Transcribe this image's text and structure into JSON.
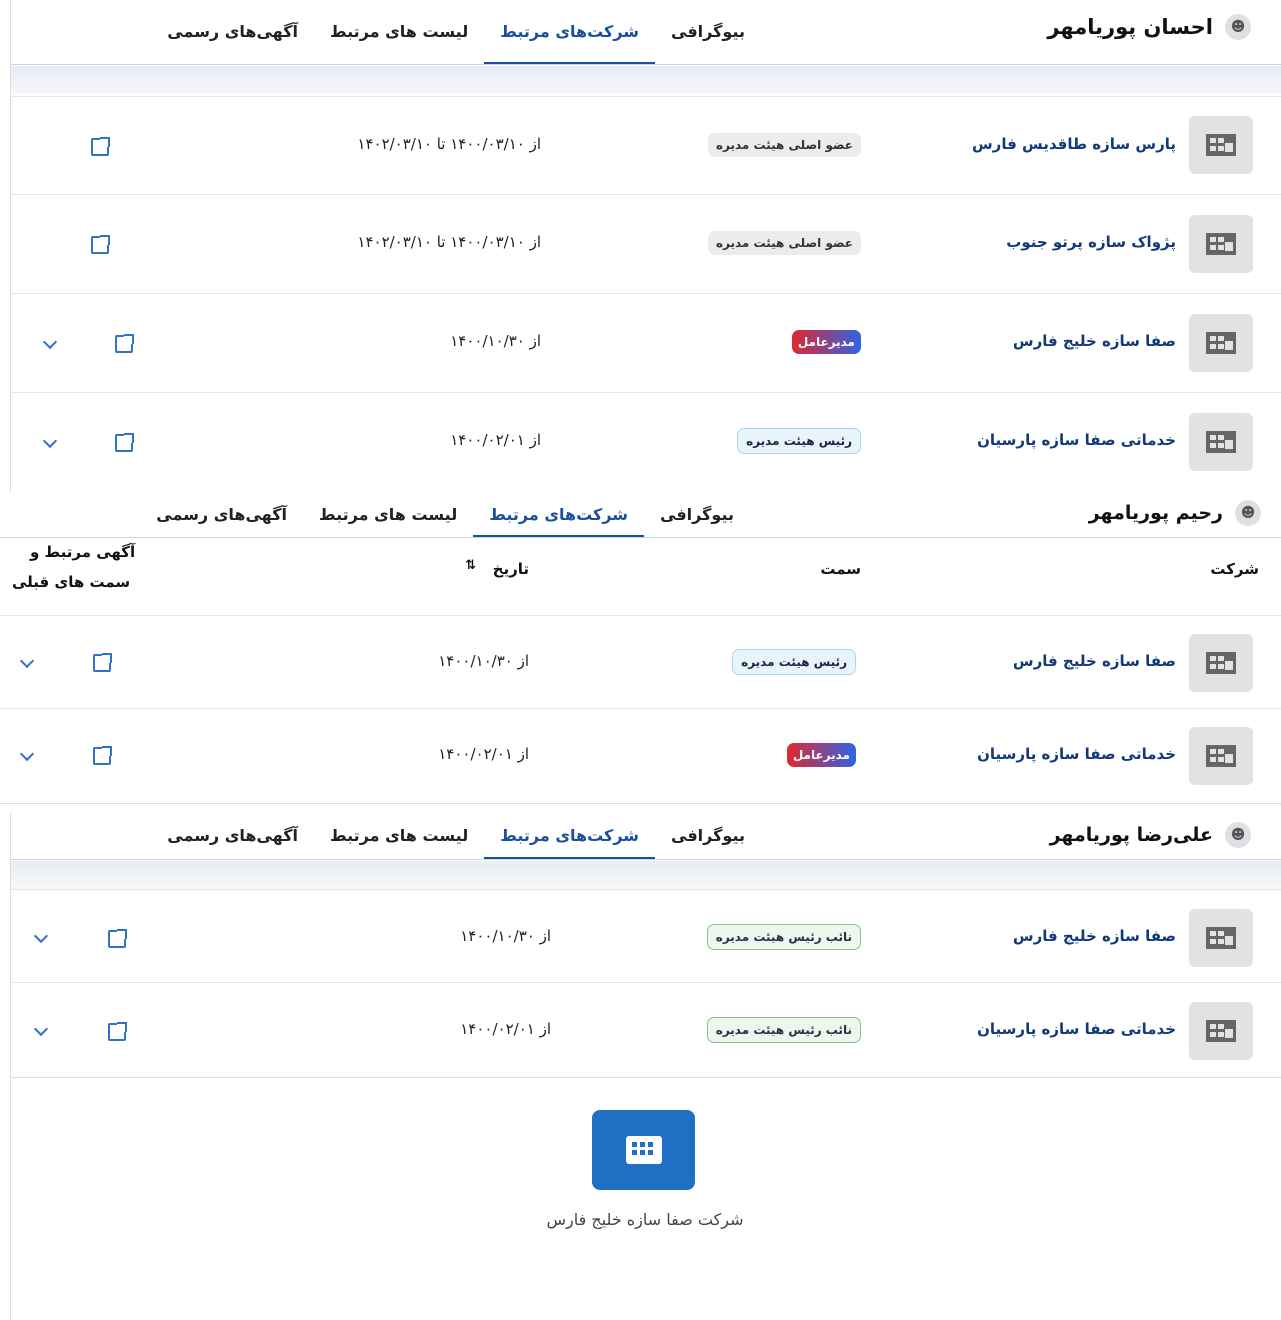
{
  "tabs": [
    "بیوگرافی",
    "شرکت‌های مرتبط",
    "لیست های مرتبط",
    "آگهی‌های رسمی"
  ],
  "panel1": {
    "person": "احسان پوریامهر",
    "rows": [
      {
        "company": "پارس سازه طاقدیس فارس",
        "role": "عضو اصلی هیئت مدیره",
        "date": "از  ۱۴۰۰/۰۳/۱۰  تا  ۱۴۰۲/۰۳/۱۰"
      },
      {
        "company": "پژواک سازه پرتو جنوب",
        "role": "عضو اصلی هیئت مدیره",
        "date": "از  ۱۴۰۰/۰۳/۱۰  تا  ۱۴۰۲/۰۳/۱۰"
      },
      {
        "company": "صفا سازه خلیج فارس",
        "role": "مدیرعامل",
        "date": "از  ۱۴۰۰/۱۰/۳۰"
      },
      {
        "company": "خدماتی صفا سازه پارسیان",
        "role": "رئیس هیئت مدیره",
        "date": "از  ۱۴۰۰/۰۲/۰۱"
      }
    ]
  },
  "panel2": {
    "person": "رحیم پوریامهر",
    "columns": {
      "company": "شرکت",
      "role": "سمت",
      "date": "تاریخ",
      "sort": "⇅",
      "related_1": "آگهی مرتبط و",
      "related_2": "سمت های قبلی"
    },
    "rows": [
      {
        "company": "صفا سازه خلیج فارس",
        "role": "رئیس هیئت مدیره",
        "date": "از  ۱۴۰۰/۱۰/۳۰"
      },
      {
        "company": "خدماتی صفا سازه پارسیان",
        "role": "مدیرعامل",
        "date": "از  ۱۴۰۰/۰۲/۰۱"
      }
    ]
  },
  "panel3": {
    "person": "علی‌رضا پوریامهر",
    "rows": [
      {
        "company": "صفا سازه خلیج فارس",
        "role": "نائب رئیس هیئت مدیره",
        "date": "از  ۱۴۰۰/۱۰/۳۰"
      },
      {
        "company": "خدماتی صفا سازه پارسیان",
        "role": "نائب رئیس هیئت مدیره",
        "date": "از  ۱۴۰۰/۰۲/۰۱"
      }
    ]
  },
  "node": {
    "label": "شرکت صفا سازه خلیج فارس",
    "icon": "building-icon"
  },
  "colors": {
    "accent": "#1c4f9e",
    "link": "#2f72c8",
    "node": "#1f6fc5"
  }
}
